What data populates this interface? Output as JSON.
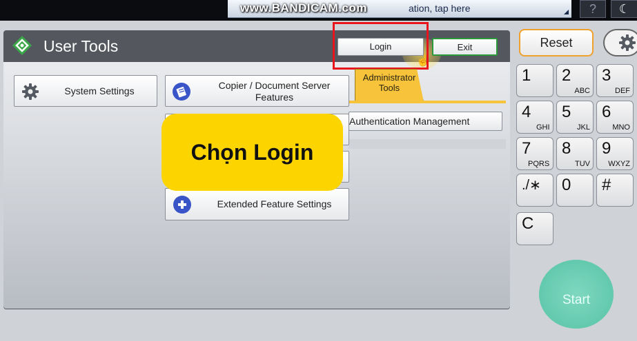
{
  "status_bar": {
    "message": "ation, tap here",
    "watermark": "www.BANDICAM.com",
    "help_label": "?",
    "night_label": "☾"
  },
  "header": {
    "title": "User Tools",
    "login_label": "Login",
    "exit_label": "Exit"
  },
  "admin_tab": {
    "label_line1": "Administrator",
    "label_line2": "Tools"
  },
  "menu": {
    "system_settings": "System Settings",
    "copier_line1": "Copier / Document Server",
    "copier_line2": "Features",
    "auth_management": "Authentication Management",
    "extended_feature": "Extended Feature Settings"
  },
  "overlay": {
    "text": "Chọn Login"
  },
  "keypad": {
    "reset_label": "Reset",
    "keys": [
      {
        "num": "1",
        "sub": ""
      },
      {
        "num": "2",
        "sub": "ABC"
      },
      {
        "num": "3",
        "sub": "DEF"
      },
      {
        "num": "4",
        "sub": "GHI"
      },
      {
        "num": "5",
        "sub": "JKL"
      },
      {
        "num": "6",
        "sub": "MNO"
      },
      {
        "num": "7",
        "sub": "PQRS"
      },
      {
        "num": "8",
        "sub": "TUV"
      },
      {
        "num": "9",
        "sub": "WXYZ"
      },
      {
        "num": "./∗",
        "sub": ""
      },
      {
        "num": "0",
        "sub": ""
      },
      {
        "num": "#",
        "sub": ""
      },
      {
        "num": "C",
        "sub": ""
      }
    ],
    "start_label": "Start"
  },
  "colors": {
    "highlight": "#e8141c",
    "overlay": "#fcd500",
    "admin_tab": "#f6c33a",
    "reset_border": "#f0a02c",
    "start": "#56c3a5"
  }
}
